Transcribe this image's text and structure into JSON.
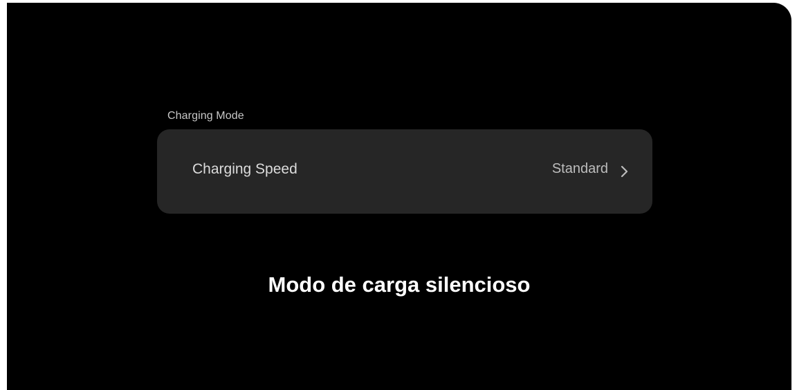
{
  "charging_mode": {
    "section_label": "Charging Mode",
    "setting": {
      "label": "Charging Speed",
      "value": "Standard",
      "icon": "chevron-right-icon"
    }
  },
  "caption": "Modo de carga silencioso",
  "colors": {
    "background": "#000000",
    "card": "#262626",
    "text_primary": "#dcdcdc",
    "text_secondary": "#bdbdbd",
    "caption": "#ffffff"
  }
}
